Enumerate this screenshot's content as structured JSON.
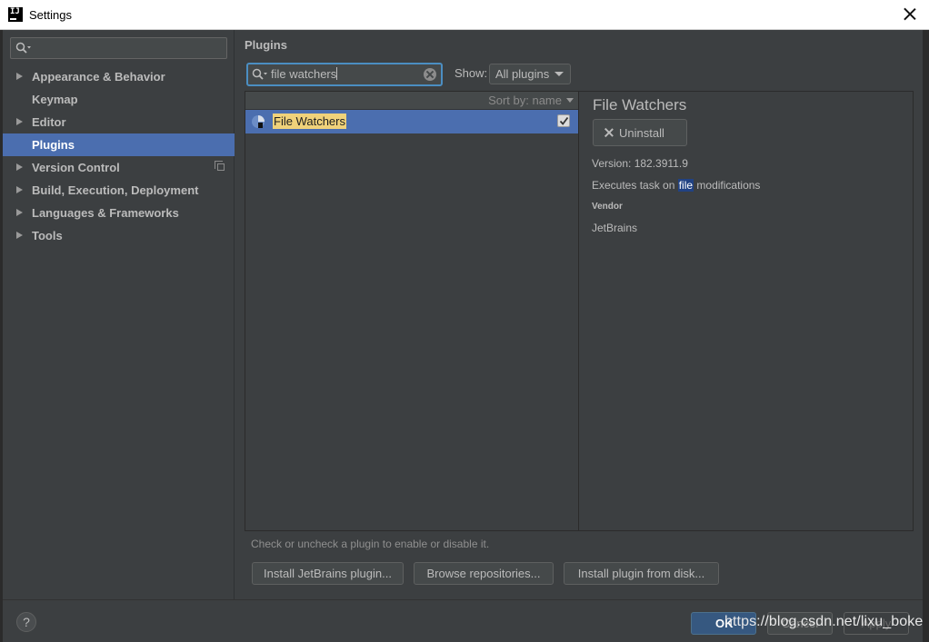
{
  "window": {
    "title": "Settings",
    "app_icon_text": "IJ"
  },
  "sidebar": {
    "search": {
      "value": "",
      "placeholder": ""
    },
    "items": [
      {
        "label": "Appearance & Behavior",
        "expandable": true,
        "selected": false
      },
      {
        "label": "Keymap",
        "expandable": false,
        "selected": false
      },
      {
        "label": "Editor",
        "expandable": true,
        "selected": false
      },
      {
        "label": "Plugins",
        "expandable": false,
        "selected": true
      },
      {
        "label": "Version Control",
        "expandable": true,
        "selected": false,
        "icon": "copy-icon"
      },
      {
        "label": "Build, Execution, Deployment",
        "expandable": true,
        "selected": false
      },
      {
        "label": "Languages & Frameworks",
        "expandable": true,
        "selected": false
      },
      {
        "label": "Tools",
        "expandable": true,
        "selected": false
      }
    ]
  },
  "main": {
    "page_title": "Plugins",
    "search": {
      "value": "file watchers"
    },
    "show": {
      "label": "Show:",
      "selected": "All plugins"
    },
    "list": {
      "sort_label": "Sort by: name",
      "plugins": [
        {
          "name": "File Watchers",
          "enabled": true,
          "selected": true
        }
      ]
    },
    "details": {
      "name": "File Watchers",
      "uninstall_label": "Uninstall",
      "version": "Version: 182.3911.9",
      "description_before": "Executes task on ",
      "description_highlight": "file",
      "description_after": " modifications",
      "vendor_label": "Vendor",
      "vendor_value": "JetBrains"
    },
    "hint": "Check or uncheck a plugin to enable or disable it.",
    "buttons": {
      "install_jetbrains": "Install JetBrains plugin...",
      "browse_repositories": "Browse repositories...",
      "install_from_disk": "Install plugin from disk..."
    }
  },
  "footer": {
    "help": "?",
    "ok": "OK",
    "cancel": "Cancel",
    "apply": "Apply",
    "watermark": "https://blog.csdn.net/lixu_boke"
  },
  "colors": {
    "accent": "#4b6eaf",
    "background": "#3c3f41",
    "search_focus": "#4b8ec2",
    "match_highlight": "#f0d27a"
  }
}
